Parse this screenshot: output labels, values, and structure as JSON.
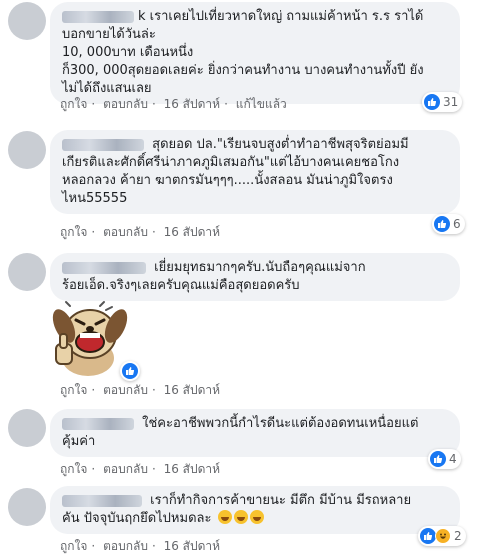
{
  "comments": [
    {
      "author_suffix": "k",
      "lines": [
        "เราเคยไปเที่ยวหาดใหญ่ ถามแม่ค้าหน้า ร.ร ราได้",
        "บอกขายได้วันล่ะ",
        "10, 000บาท เดือนหนึ่ง",
        "ก็300, 000สุดยอดเลยค่ะ ยิ่งกว่าคนทำงาน บางคนทำงานทั้งปี ยัง",
        "ไม่ได้ถึงแสนเลย"
      ],
      "like_label": "ถูกใจ",
      "reply_label": "ตอบกลับ",
      "time": "16 สัปดาห์",
      "edited": "แก้ไขแล้ว",
      "reaction_count": "31"
    },
    {
      "author_suffix": "",
      "lines": [
        "สุดยอด ปล.\"เรียนจบสูงต่ำทำอาชีพสุจริตย่อมมี",
        "เกียรติและศักดิ์ศรีน่าภาคภูมิเสมอกัน\"แต่ไอ้บางคนเคยชอโกง",
        "หลอกลวง ค้ายา ฆาตกรมันๆๆๆ.....นั้งสลอน มันน่าภูมิใจตรง",
        "ไหน55555"
      ],
      "like_label": "ถูกใจ",
      "reply_label": "ตอบกลับ",
      "time": "16 สัปดาห์",
      "reaction_count": "6"
    },
    {
      "author_suffix": "",
      "lines": [
        "เยี่ยมยุทธมากๆครับ.นับถือๆคุณแม่จาก",
        "ร้อยเอ็ด.จริงๆเลยครับคุณแม่คือสุดยอดครับ"
      ],
      "like_label": "ถูกใจ",
      "reply_label": "ตอบกลับ",
      "time": "16 สัปดาห์",
      "reaction_count": ""
    },
    {
      "author_suffix": "",
      "lines": [
        "ใช่คะอาชีพพวกนี้กำไรดีนะแต่ต้องอดทนเหนื่อยแต่",
        "คุ้มค่า"
      ],
      "like_label": "ถูกใจ",
      "reply_label": "ตอบกลับ",
      "time": "16 สัปดาห์",
      "reaction_count": "4"
    },
    {
      "author_suffix": "",
      "lines": [
        "เราก็ทำกิจการค้าขายนะ มีตึก มีบ้าน มีรถหลาย",
        "คัน ปัจจุบันฤกยึดไปหมดละ"
      ],
      "like_label": "ถูกใจ",
      "reply_label": "ตอบกลับ",
      "time": "16 สัปดาห์",
      "reaction_count": "2"
    }
  ],
  "icons": {
    "reaction_like": "like-icon",
    "reaction_haha": "haha-icon",
    "emoji": "grinning-face-icon",
    "sticker": "thumbs-up-dog-sticker"
  },
  "colors": {
    "bubble": "#f0f2f5",
    "like_blue": "#1877f2",
    "meta_gray": "#65676b"
  }
}
